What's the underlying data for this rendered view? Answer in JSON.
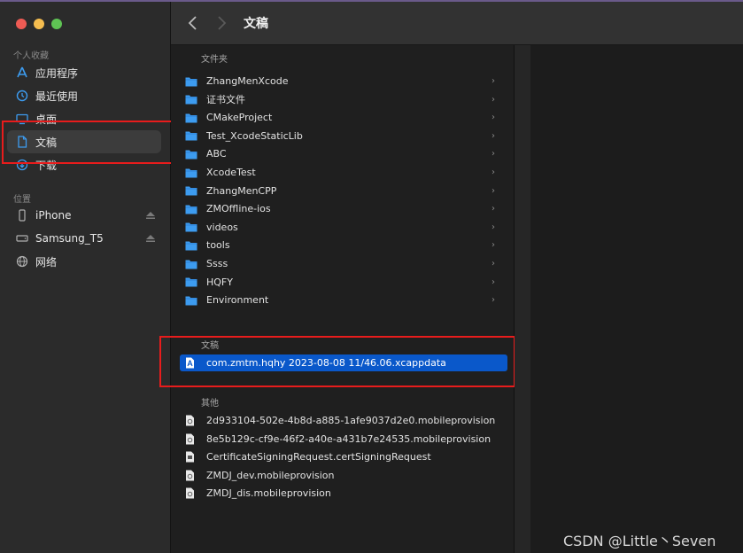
{
  "toolbar": {
    "title": "文稿"
  },
  "sidebar": {
    "favorites_header": "个人收藏",
    "favorites": [
      {
        "label": "应用程序",
        "icon": "applications-icon"
      },
      {
        "label": "最近使用",
        "icon": "recents-icon"
      },
      {
        "label": "桌面",
        "icon": "desktop-icon"
      },
      {
        "label": "文稿",
        "icon": "document-icon"
      },
      {
        "label": "下载",
        "icon": "downloads-icon"
      }
    ],
    "locations_header": "位置",
    "locations": [
      {
        "label": "iPhone",
        "icon": "iphone-icon"
      },
      {
        "label": "Samsung_T5",
        "icon": "drive-icon"
      },
      {
        "label": "网络",
        "icon": "network-icon"
      }
    ]
  },
  "column": {
    "folders_header": "文件夹",
    "folders": [
      "ZhangMenXcode",
      "证书文件",
      "CMakeProject",
      "Test_XcodeStaticLib",
      "ABC",
      "XcodeTest",
      "ZhangMenCPP",
      "ZMOffline-ios",
      "videos",
      "tools",
      "Ssss",
      "HQFY",
      "Environment"
    ],
    "documents_header": "文稿",
    "documents": [
      "com.zmtm.hqhy 2023-08-08 11/46.06.xcappdata"
    ],
    "other_header": "其他",
    "other": [
      "2d933104-502e-4b8d-a885-1afe9037d2e0.mobileprovision",
      "8e5b129c-cf9e-46f2-a40e-a431b7e24535.mobileprovision",
      "CertificateSigningRequest.certSigningRequest",
      "ZMDJ_dev.mobileprovision",
      "ZMDJ_dis.mobileprovision"
    ]
  },
  "watermark": "CSDN @Little丶Seven",
  "colors": {
    "highlight": "#e81c1c",
    "selection": "#0a58ca",
    "folder": "#3d9cf0"
  }
}
